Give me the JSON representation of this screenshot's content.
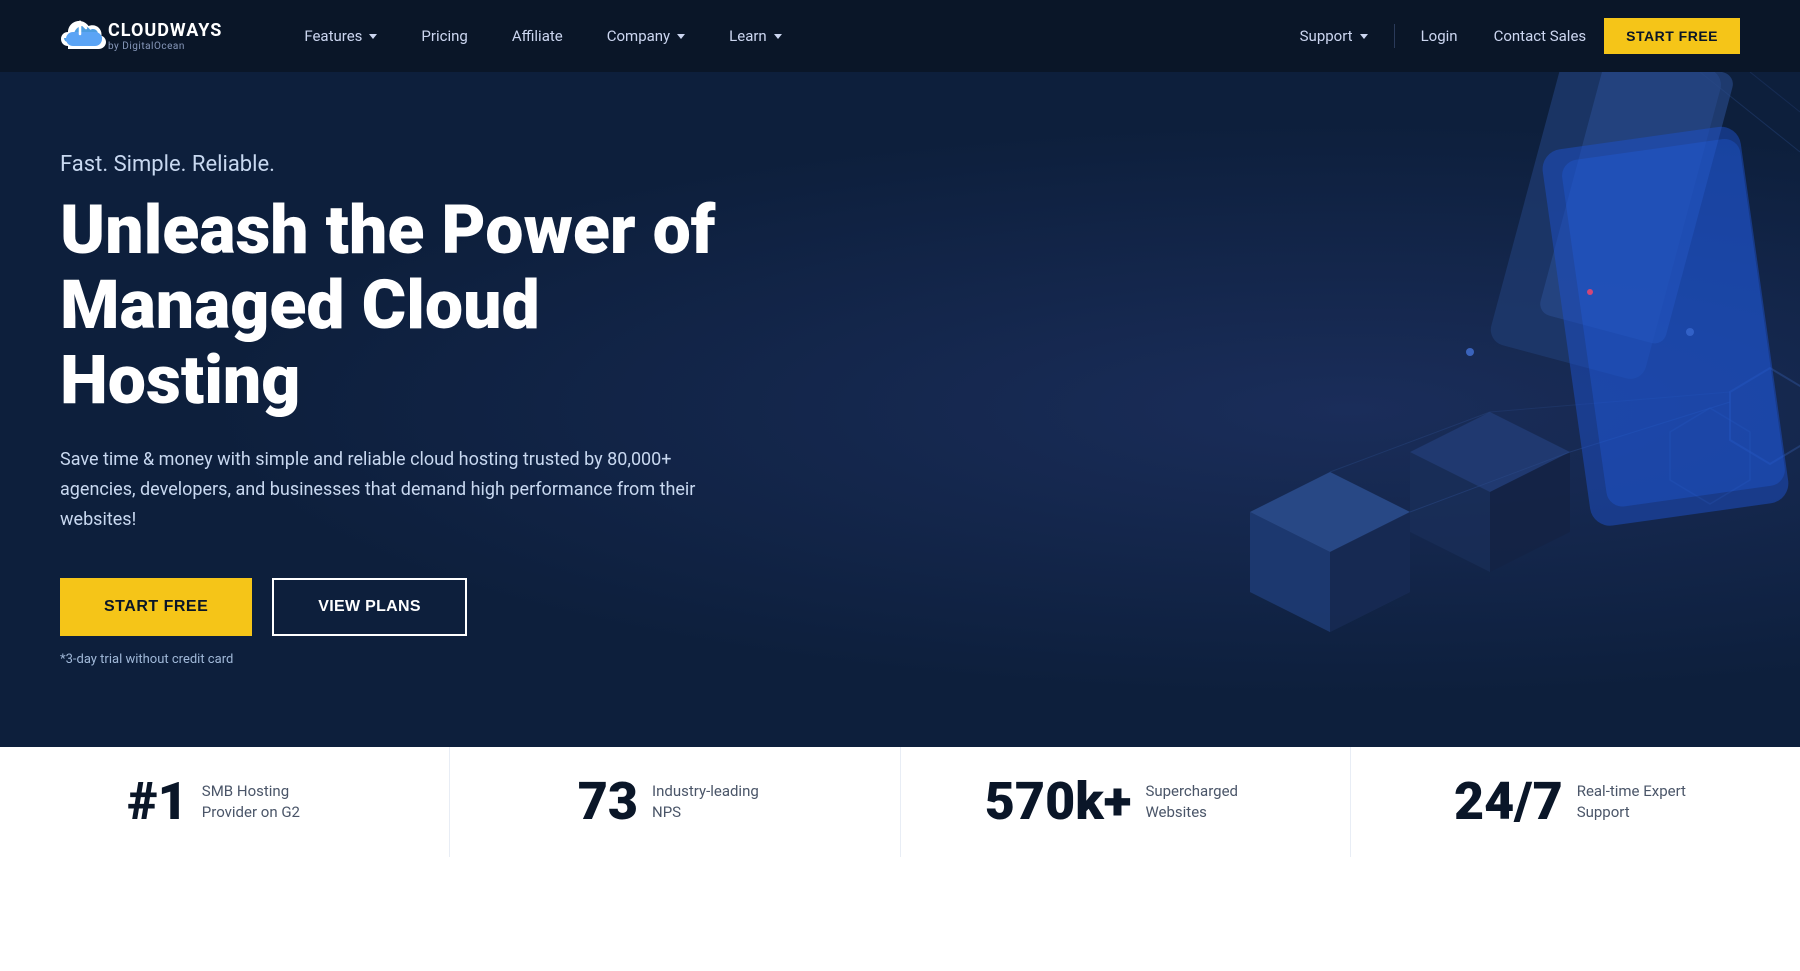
{
  "brand": {
    "name": "CLOUDWAYS",
    "tagline": "by DigitalOcean"
  },
  "nav": {
    "items": [
      {
        "label": "Features",
        "has_dropdown": true
      },
      {
        "label": "Pricing",
        "has_dropdown": false
      },
      {
        "label": "Affiliate",
        "has_dropdown": false
      },
      {
        "label": "Company",
        "has_dropdown": true
      },
      {
        "label": "Learn",
        "has_dropdown": true
      }
    ],
    "right_items": [
      {
        "label": "Support",
        "has_dropdown": true
      },
      {
        "label": "Login",
        "has_dropdown": false
      },
      {
        "label": "Contact Sales",
        "has_dropdown": false
      }
    ],
    "cta_label": "START FREE"
  },
  "hero": {
    "tagline": "Fast. Simple. Reliable.",
    "title": "Unleash the Power of Managed Cloud Hosting",
    "description": "Save time & money with simple and reliable cloud hosting trusted by 80,000+ agencies, developers, and businesses that demand high performance from their websites!",
    "btn_primary": "START FREE",
    "btn_secondary": "VIEW PLANS",
    "note": "*3-day trial without credit card"
  },
  "stats": [
    {
      "number": "#1",
      "label": "SMB Hosting Provider on G2"
    },
    {
      "number": "73",
      "label": "Industry-leading NPS"
    },
    {
      "number": "570k+",
      "label": "Supercharged Websites"
    },
    {
      "number": "24/7",
      "label": "Real-time Expert Support"
    }
  ]
}
